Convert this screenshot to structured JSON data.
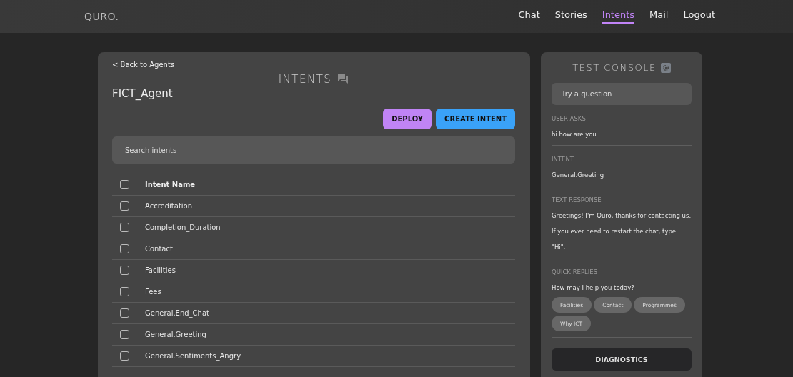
{
  "nav": {
    "logo": "QURO.",
    "links": [
      {
        "label": "Chat",
        "selected": false
      },
      {
        "label": "Stories",
        "selected": false
      },
      {
        "label": "Intents",
        "selected": true
      },
      {
        "label": "Mail",
        "selected": false
      },
      {
        "label": "Logout",
        "selected": false
      }
    ]
  },
  "intents": {
    "back": "< Back to Agents",
    "title": "INTENTS",
    "agent": "FICT_Agent",
    "buttons": [
      {
        "label": "DEPLOY",
        "kind": "deploy"
      },
      {
        "label": "CREATE INTENT",
        "kind": "create"
      }
    ],
    "search": {
      "placeholder": "Search intents"
    },
    "table": {
      "header": {
        "label": "Intent Name",
        "checked": false
      },
      "rows": [
        {
          "name": "Accreditation",
          "checked": false
        },
        {
          "name": "Completion_Duration",
          "checked": false
        },
        {
          "name": "Contact",
          "checked": false
        },
        {
          "name": "Facilities",
          "checked": false
        },
        {
          "name": "Fees",
          "checked": false
        },
        {
          "name": "General.End_Chat",
          "checked": false
        },
        {
          "name": "General.Greeting",
          "checked": false
        },
        {
          "name": "General.Sentiments_Angry",
          "checked": false
        }
      ]
    }
  },
  "console": {
    "title": "TEST CONSOLE",
    "input": {
      "placeholder": "Try a question"
    },
    "sections": [
      {
        "label": "USER ASKS",
        "lines": [
          "hi how are you"
        ]
      },
      {
        "label": "INTENT",
        "lines": [
          "General.Greeting"
        ]
      },
      {
        "label": "TEXT RESPONSE",
        "lines": [
          "Greetings! I'm Quro, thanks for contacting us.",
          "If you ever need to restart the chat, type \"Hi\"."
        ]
      }
    ],
    "quick_replies": {
      "label": "QUICK REPLIES",
      "prompt": "How may I help you today?",
      "chips": [
        "Facilities",
        "Contact",
        "Programmes",
        "Why ICT"
      ]
    },
    "diagnostics": "DIAGNOSTICS"
  }
}
